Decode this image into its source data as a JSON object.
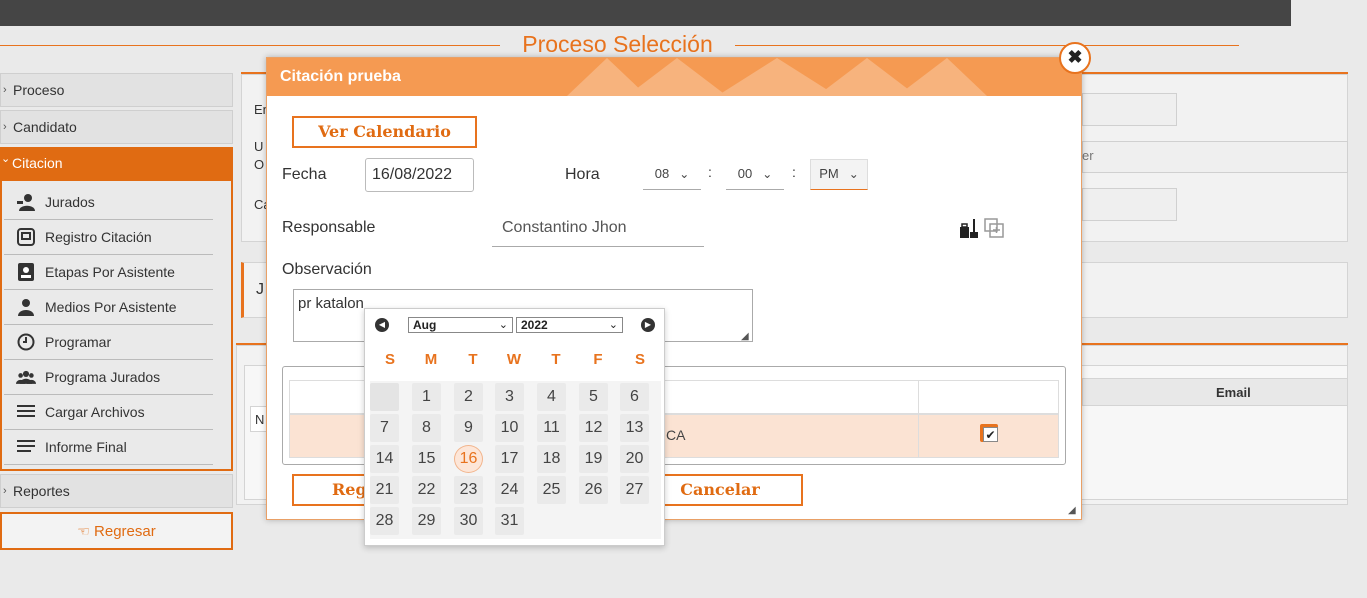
{
  "page": {
    "title": "Proceso Selección"
  },
  "sidebar": {
    "items_top": [
      {
        "label": "Proceso"
      },
      {
        "label": "Candidato"
      }
    ],
    "active": {
      "label": "Citacion"
    },
    "submenu": [
      {
        "label": "Jurados",
        "icon": "user-badge-icon"
      },
      {
        "label": "Registro Citación",
        "icon": "registry-icon"
      },
      {
        "label": "Etapas Por Asistente",
        "icon": "stages-icon"
      },
      {
        "label": "Medios Por Asistente",
        "icon": "person-icon"
      },
      {
        "label": "Programar",
        "icon": "clock-icon"
      },
      {
        "label": "Programa Jurados",
        "icon": "group-icon"
      },
      {
        "label": "Cargar Archivos",
        "icon": "upload-lines-icon"
      },
      {
        "label": "Informe Final",
        "icon": "report-lines-icon"
      }
    ],
    "reportes": {
      "label": "Reportes"
    },
    "regresar": {
      "label": "Regresar"
    }
  },
  "background": {
    "frag_en": "En",
    "frag_u": "U",
    "frag_o": "O",
    "frag_c": "Ca",
    "frag_j": "J",
    "frag_n": "N",
    "frag_er": "er",
    "email_header": "Email"
  },
  "modal": {
    "title": "Citación prueba",
    "ver_calendario": "Ver Calendario",
    "fecha_label": "Fecha",
    "fecha_value": "16/08/2022",
    "hora_label": "Hora",
    "hora_h": "08",
    "hora_m": "00",
    "hora_ampm": "PM",
    "colon": ":",
    "responsable_label": "Responsable",
    "responsable_value": "Constantino  Jhon",
    "observacion_label": "Observación",
    "observacion_value": "pr katalon",
    "row_fragment": "CA",
    "registrar_fragment": "Reg",
    "cancelar": "Cancelar"
  },
  "datepicker": {
    "month": "Aug",
    "year": "2022",
    "weekdays": [
      "S",
      "M",
      "T",
      "W",
      "T",
      "F",
      "S"
    ],
    "weeks": [
      [
        "",
        "1",
        "2",
        "3",
        "4",
        "5",
        "6"
      ],
      [
        "7",
        "8",
        "9",
        "10",
        "11",
        "12",
        "13"
      ],
      [
        "14",
        "15",
        "16",
        "17",
        "18",
        "19",
        "20"
      ],
      [
        "21",
        "22",
        "23",
        "24",
        "25",
        "26",
        "27"
      ],
      [
        "28",
        "29",
        "30",
        "31",
        "",
        "",
        ""
      ]
    ],
    "selected": "16"
  },
  "colors": {
    "accent": "#e8731e",
    "header": "#f59a52",
    "topbar": "#454545"
  }
}
